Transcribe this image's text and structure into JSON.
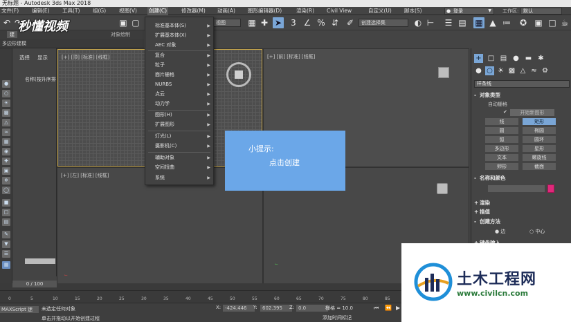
{
  "app": {
    "title": "无标题 - Autodesk 3ds Max 2018"
  },
  "menubar": {
    "items": [
      "文件(F)",
      "编辑(E)",
      "工具(T)",
      "组(G)",
      "视图(V)",
      "创建(C)",
      "修改器(M)",
      "动画(A)",
      "图形编辑器(D)",
      "渲染(R)",
      "Civil View",
      "自定义(U)",
      "脚本(S)"
    ],
    "active": "创建(C)",
    "login": "登录",
    "workspace_label": "工作区:",
    "workspace_value": "默认"
  },
  "toolbar": {
    "view_dropdown": "视图",
    "selection_set": "创建选择集"
  },
  "ribbon": {
    "tabs": [
      "建",
      "",
      "对象绘制"
    ],
    "panel_label": "多边形建模"
  },
  "scene_explorer": {
    "tabs": [
      "选择",
      "显示"
    ],
    "sort_label": "名称(按升序排"
  },
  "create_menu": {
    "items": [
      {
        "label": "标准基本体(S)",
        "sub": true
      },
      {
        "label": "扩展基本体(X)",
        "sub": true
      },
      {
        "label": "AEC 对象",
        "sub": true
      },
      {
        "label": "复合",
        "sub": true
      },
      {
        "label": "粒子",
        "sub": true
      },
      {
        "label": "面片栅格",
        "sub": true
      },
      {
        "label": "NURBS",
        "sub": true
      },
      {
        "label": "点云",
        "sub": true
      },
      {
        "label": "动力学",
        "sub": true
      },
      {
        "label": "图形(H)",
        "sub": true
      },
      {
        "label": "扩展图形",
        "sub": true
      },
      {
        "label": "灯光(L)",
        "sub": true
      },
      {
        "label": "摄影机(C)",
        "sub": true
      },
      {
        "label": "辅助对象",
        "sub": true
      },
      {
        "label": "空间扭曲",
        "sub": true
      },
      {
        "label": "系统",
        "sub": true
      }
    ]
  },
  "viewports": {
    "top_label": "[+] [顶] [标准] [线框]",
    "front_label": "[+] [前] [标准] [线框]",
    "left_label": "[+] [左] [标准] [线框]"
  },
  "tip": {
    "title": "小提示:",
    "body": "点击创建"
  },
  "command_panel": {
    "dropdown": "样条线",
    "sections": {
      "object_type": "对象类型",
      "name_color": "名称和颜色",
      "render": "渲染",
      "interpolation": "插值",
      "creation_method": "创建方法",
      "keyboard": "键盘输入"
    },
    "autogrid": "自动栅格",
    "start_new_shape": "开始新图形",
    "buttons": [
      "线",
      "矩形",
      "圆",
      "椭圆",
      "弧",
      "圆环",
      "多边形",
      "星形",
      "文本",
      "螺旋线",
      "卵形",
      "截面"
    ],
    "active_button": "矩形",
    "creation_options": [
      "边",
      "中心"
    ]
  },
  "timeline": {
    "slider": "0 / 100",
    "ticks": [
      "0",
      "5",
      "10",
      "15",
      "20",
      "25",
      "30",
      "35",
      "40",
      "45",
      "50",
      "55",
      "60",
      "65",
      "70",
      "75",
      "80",
      "85"
    ]
  },
  "statusbar": {
    "maxscript": "MAXScript 迷",
    "status1": "未选定任何对象",
    "status2": "单击并拖动以开始创建过程",
    "x_label": "X:",
    "x_value": "-424.446",
    "y_label": "Y:",
    "y_value": "602.395",
    "z_label": "Z:",
    "z_value": "0.0",
    "grid": "栅格 = 10.0",
    "add_time_tag": "添加时间标记"
  },
  "watermark": {
    "name": "土木工程网",
    "url": "www.civilcn.com",
    "brand": "秒懂视频"
  },
  "colors": {
    "accent": "#7aa6d6",
    "tip_bg": "#6ba7e8",
    "swatch": "#e0287a",
    "viewport_active_border": "#c9a84a"
  }
}
